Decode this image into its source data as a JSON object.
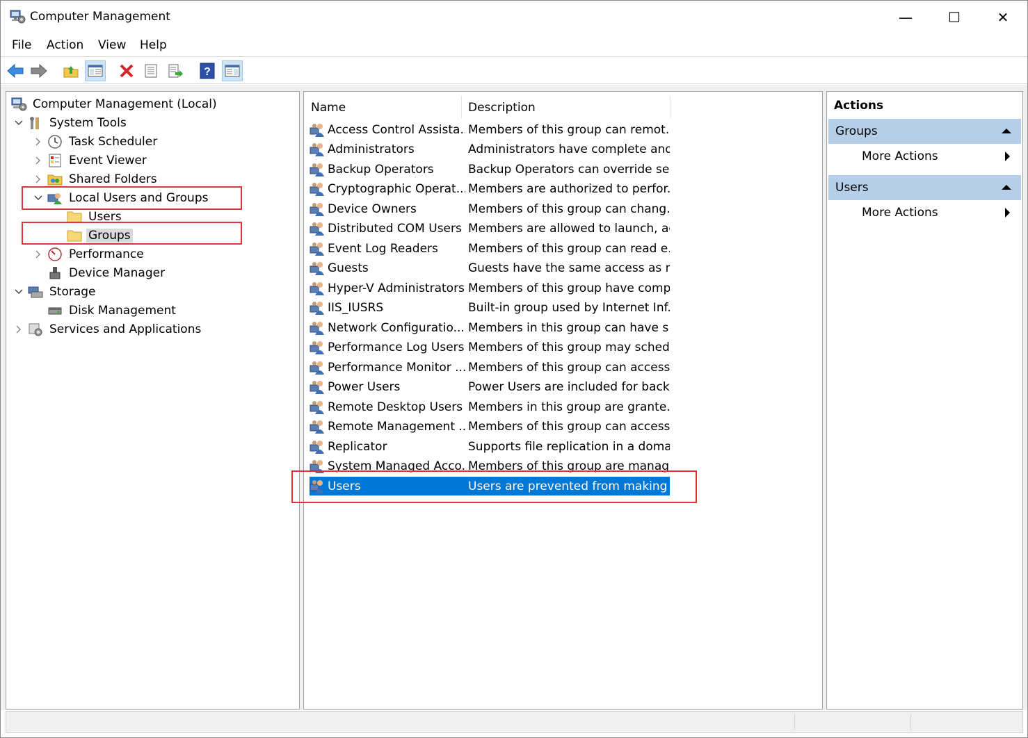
{
  "window": {
    "title": "Computer Management",
    "minimize_glyph": "—",
    "maximize_glyph": "☐",
    "close_glyph": "✕"
  },
  "menu": [
    "File",
    "Action",
    "View",
    "Help"
  ],
  "toolbar": {
    "buttons": [
      "back-icon",
      "forward-icon",
      "up-folder-icon",
      "show-hide-tree-icon",
      "delete-icon",
      "properties-icon",
      "export-list-icon",
      "help-icon",
      "show-hide-action-pane-icon"
    ]
  },
  "tree": {
    "items": [
      {
        "label": "Computer Management (Local)",
        "icon": "computer-management-icon",
        "expander": "none"
      },
      {
        "label": "System Tools",
        "icon": "system-tools-icon",
        "expander": "expanded"
      },
      {
        "label": "Task Scheduler",
        "icon": "task-scheduler-icon",
        "expander": "collapsed"
      },
      {
        "label": "Event Viewer",
        "icon": "event-viewer-icon",
        "expander": "collapsed"
      },
      {
        "label": "Shared Folders",
        "icon": "shared-folders-icon",
        "expander": "collapsed"
      },
      {
        "label": "Local Users and Groups",
        "icon": "local-users-groups-icon",
        "expander": "expanded"
      },
      {
        "label": "Users",
        "icon": "folder-icon",
        "expander": "none"
      },
      {
        "label": "Groups",
        "icon": "folder-icon",
        "expander": "none"
      },
      {
        "label": "Performance",
        "icon": "performance-icon",
        "expander": "collapsed"
      },
      {
        "label": "Device Manager",
        "icon": "device-manager-icon",
        "expander": "none"
      },
      {
        "label": "Storage",
        "icon": "storage-icon",
        "expander": "expanded"
      },
      {
        "label": "Disk Management",
        "icon": "disk-management-icon",
        "expander": "none"
      },
      {
        "label": "Services and Applications",
        "icon": "services-applications-icon",
        "expander": "collapsed"
      }
    ],
    "selected": "Groups"
  },
  "list": {
    "columns": [
      "Name",
      "Description"
    ],
    "rows": [
      {
        "name": "Access Control Assista...",
        "description": "Members of this group can remot..."
      },
      {
        "name": "Administrators",
        "description": "Administrators have complete and..."
      },
      {
        "name": "Backup Operators",
        "description": "Backup Operators can override sec..."
      },
      {
        "name": "Cryptographic Operat...",
        "description": "Members are authorized to perfor..."
      },
      {
        "name": "Device Owners",
        "description": "Members of this group can chang..."
      },
      {
        "name": "Distributed COM Users",
        "description": "Members are allowed to launch, ac..."
      },
      {
        "name": "Event Log Readers",
        "description": "Members of this group can read e..."
      },
      {
        "name": "Guests",
        "description": "Guests have the same access as m..."
      },
      {
        "name": "Hyper-V Administrators",
        "description": "Members of this group have comp..."
      },
      {
        "name": "IIS_IUSRS",
        "description": "Built-in group used by Internet Inf..."
      },
      {
        "name": "Network Configuratio...",
        "description": "Members in this group can have s..."
      },
      {
        "name": "Performance Log Users",
        "description": "Members of this group may sched..."
      },
      {
        "name": "Performance Monitor ...",
        "description": "Members of this group can access ..."
      },
      {
        "name": "Power Users",
        "description": "Power Users are included for back..."
      },
      {
        "name": "Remote Desktop Users",
        "description": "Members in this group are grante..."
      },
      {
        "name": "Remote Management ...",
        "description": "Members of this group can access ..."
      },
      {
        "name": "Replicator",
        "description": "Supports file replication in a doma..."
      },
      {
        "name": "System Managed Acco...",
        "description": "Members of this group are manag..."
      },
      {
        "name": "Users",
        "description": "Users are prevented from making ..."
      }
    ],
    "selected": "Users"
  },
  "actions": {
    "header": "Actions",
    "sections": [
      {
        "title": "Groups",
        "items": [
          "More Actions"
        ]
      },
      {
        "title": "Users",
        "items": [
          "More Actions"
        ]
      }
    ]
  },
  "colors": {
    "selection": "#0078d7",
    "action_section": "#b6cfe8",
    "highlight_box": "#e0343c"
  }
}
